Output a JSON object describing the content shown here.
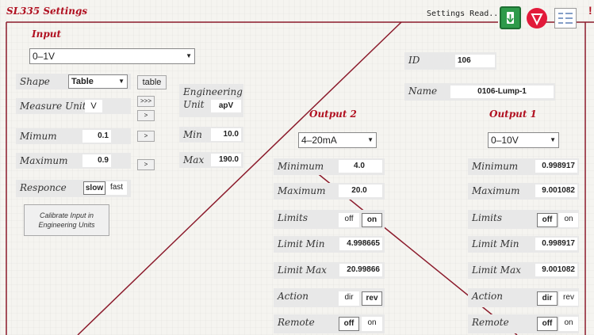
{
  "title": "SL335 Settings",
  "status": "Settings Read..",
  "alert_mark": "!",
  "colors": {
    "accent": "#8b1a2b",
    "download": "#2e9a4a",
    "alert": "#e21a3a"
  },
  "toolbar": {
    "icons": [
      "arrow-down-icon",
      "warning-icon",
      "checklist-icon"
    ]
  },
  "input": {
    "heading": "Input",
    "type": "0–1V",
    "shape_label": "Shape",
    "shape": "Table",
    "table_btn": "table",
    "measure_unit_label": "Measure Unit",
    "measure_unit": "V",
    "triple_btn": ">>>",
    "arrow_btn": ">",
    "min_label": "Mimum",
    "min": "0.1",
    "max_label": "Maximum",
    "max": "0.9",
    "responce_label": "Responce",
    "slow": "slow",
    "fast": "fast",
    "calibrate_btn": "Calibrate Input in Engineering Units"
  },
  "engineering": {
    "heading": "Engineering",
    "unit_label": "Unit",
    "unit": "apV",
    "min_label": "Min",
    "min": "10.0",
    "max_label": "Max",
    "max": "190.0"
  },
  "device": {
    "id_label": "ID",
    "id": "106",
    "name_label": "Name",
    "name": "0106-Lump-1"
  },
  "output2": {
    "heading": "Output 2",
    "type": "4–20mA",
    "min_label": "Minimum",
    "min": "4.0",
    "max_label": "Maximum",
    "max": "20.0",
    "limits_label": "Limits",
    "off": "off",
    "on": "on",
    "limit_min_label": "Limit Min",
    "limit_min": "4.998665",
    "limit_max_label": "Limit Max",
    "limit_max": "20.99866",
    "action_label": "Action",
    "dir": "dir",
    "rev": "rev",
    "remote_label": "Remote",
    "remote_off": "off",
    "remote_on": "on"
  },
  "output1": {
    "heading": "Output 1",
    "type": "0–10V",
    "min_label": "Minimum",
    "min": "0.998917",
    "max_label": "Maximum",
    "max": "9.001082",
    "limits_label": "Limits",
    "off": "off",
    "on": "on",
    "limit_min_label": "Limit Min",
    "limit_min": "0.998917",
    "limit_max_label": "Limit Max",
    "limit_max": "9.001082",
    "action_label": "Action",
    "dir": "dir",
    "rev": "rev",
    "remote_label": "Remote",
    "remote_off": "off",
    "remote_on": "on"
  }
}
